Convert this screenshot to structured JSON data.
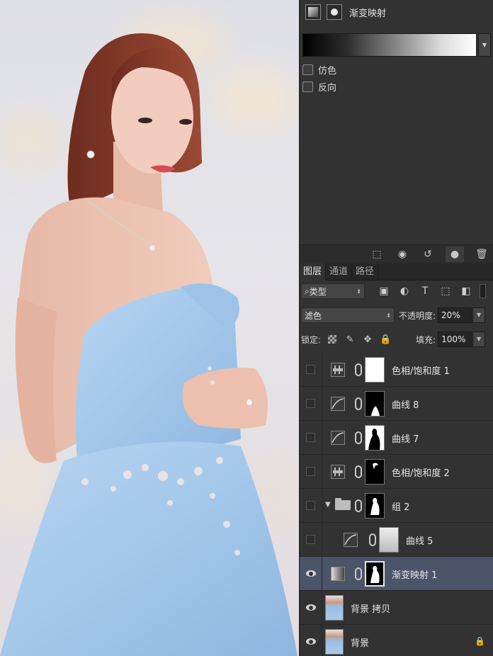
{
  "properties": {
    "title": "渐变映射",
    "options": [
      {
        "label": "仿色"
      },
      {
        "label": "反向"
      }
    ]
  },
  "layers_panel": {
    "tabs": [
      {
        "label": "图层",
        "active": true
      },
      {
        "label": "通道",
        "active": false
      },
      {
        "label": "路径",
        "active": false
      }
    ],
    "filter_type": "类型",
    "blend_mode": "滤色",
    "opacity_label": "不透明度:",
    "opacity_value": "20%",
    "lock_label": "锁定:",
    "fill_label": "填充:",
    "fill_value": "100%",
    "layers": [
      {
        "name": "色相/饱和度 1",
        "type": "hue-saturation",
        "visible": false,
        "selected": false
      },
      {
        "name": "曲线 8",
        "type": "curves",
        "visible": false,
        "selected": false
      },
      {
        "name": "曲线 7",
        "type": "curves",
        "visible": false,
        "selected": false
      },
      {
        "name": "色相/饱和度 2",
        "type": "hue-saturation",
        "visible": false,
        "selected": false
      },
      {
        "name": "组 2",
        "type": "group",
        "visible": false,
        "selected": false,
        "expanded": true
      },
      {
        "name": "曲线 5",
        "type": "curves",
        "visible": false,
        "selected": false,
        "indent": true
      },
      {
        "name": "渐变映射 1",
        "type": "gradient-map",
        "visible": true,
        "selected": true
      },
      {
        "name": "背景 拷贝",
        "type": "pixel",
        "visible": true,
        "selected": false
      },
      {
        "name": "背景",
        "type": "pixel",
        "visible": true,
        "selected": false,
        "locked": true
      }
    ]
  },
  "colors": {
    "panel_bg": "#323232",
    "selected_row": "#4b5469",
    "dress": "#a8cbeb",
    "hair": "#7d3424"
  }
}
